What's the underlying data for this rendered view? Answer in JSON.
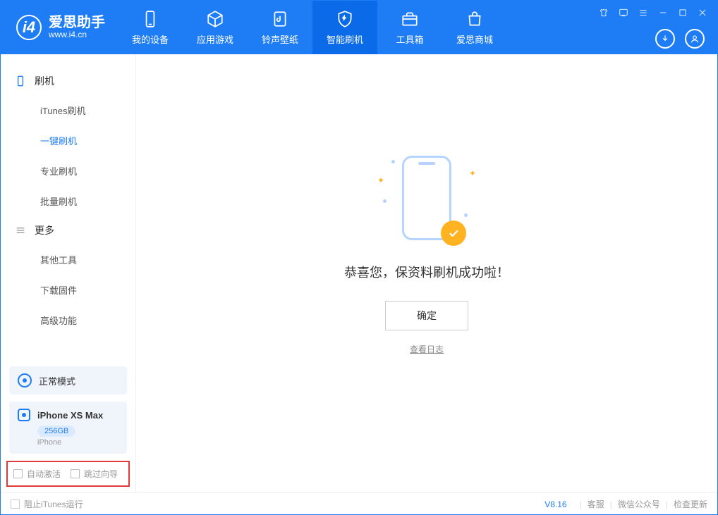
{
  "app": {
    "title": "爱思助手",
    "url": "www.i4.cn"
  },
  "nav": {
    "my_device": "我的设备",
    "apps_games": "应用游戏",
    "ringtones": "铃声壁纸",
    "smart_flash": "智能刷机",
    "toolbox": "工具箱",
    "store": "爱思商城"
  },
  "sidebar": {
    "group_flash": "刷机",
    "items_flash": [
      "iTunes刷机",
      "一键刷机",
      "专业刷机",
      "批量刷机"
    ],
    "group_more": "更多",
    "items_more": [
      "其他工具",
      "下载固件",
      "高级功能"
    ]
  },
  "mode": {
    "label": "正常模式"
  },
  "device": {
    "name": "iPhone XS Max",
    "storage": "256GB",
    "type": "iPhone"
  },
  "options": {
    "auto_activate": "自动激活",
    "skip_guide": "跳过向导"
  },
  "main": {
    "success": "恭喜您，保资料刷机成功啦！",
    "confirm": "确定",
    "view_log": "查看日志"
  },
  "footer": {
    "block_itunes": "阻止iTunes运行",
    "version": "V8.16",
    "service": "客服",
    "wechat": "微信公众号",
    "check_update": "检查更新"
  }
}
